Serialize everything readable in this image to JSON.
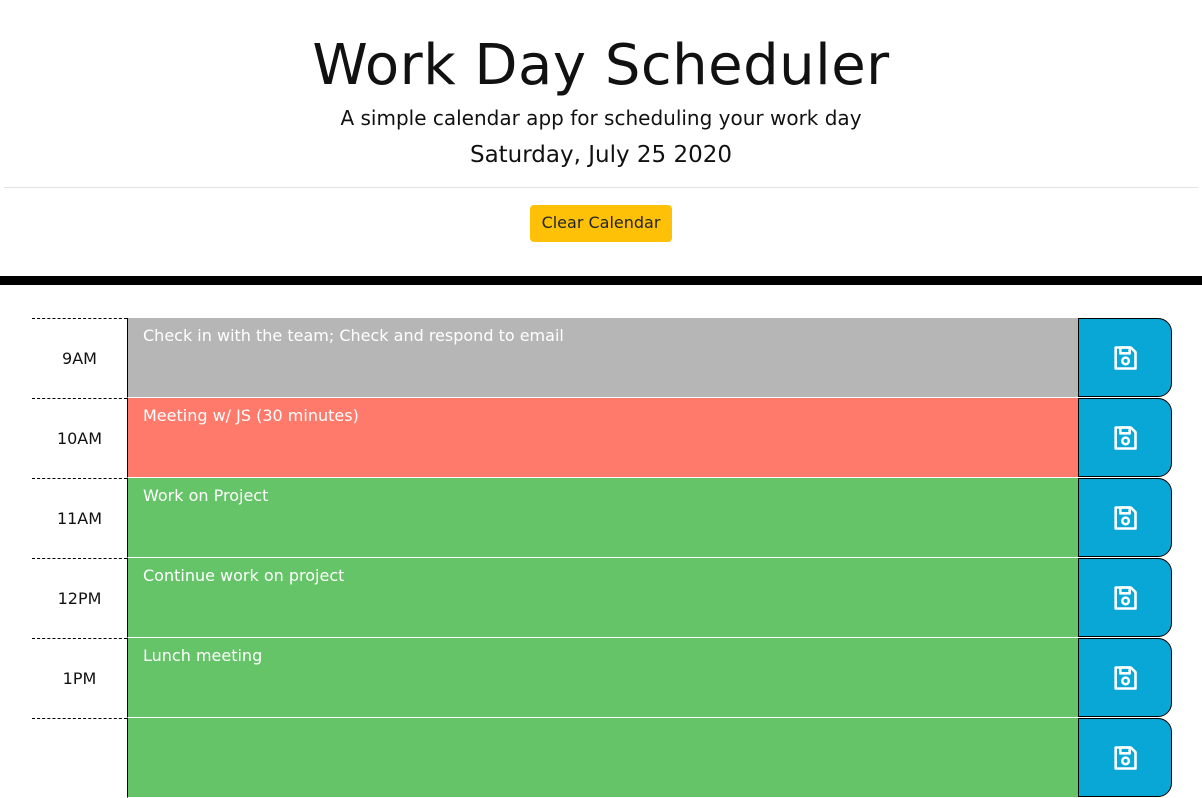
{
  "header": {
    "title": "Work Day Scheduler",
    "subtitle": "A simple calendar app for scheduling your work day",
    "current_date": "Saturday, July 25 2020"
  },
  "controls": {
    "clear_label": "Clear Calendar"
  },
  "colors": {
    "past": "#b6b6b6",
    "present": "#ff7a6b",
    "future": "#65c468",
    "save_button": "#09a7d6",
    "clear_button": "#ffc107"
  },
  "schedule": [
    {
      "hour": "9AM",
      "text": "Check in with the team; Check and respond to email",
      "state": "past",
      "icon": "save-icon"
    },
    {
      "hour": "10AM",
      "text": "Meeting w/ JS (30 minutes)",
      "state": "present",
      "icon": "save-icon"
    },
    {
      "hour": "11AM",
      "text": "Work on Project",
      "state": "future",
      "icon": "save-icon"
    },
    {
      "hour": "12PM",
      "text": "Continue work on project",
      "state": "future",
      "icon": "save-icon"
    },
    {
      "hour": "1PM",
      "text": "Lunch meeting",
      "state": "future",
      "icon": "save-icon"
    },
    {
      "hour": "",
      "text": "",
      "state": "future",
      "icon": "save-icon"
    }
  ]
}
